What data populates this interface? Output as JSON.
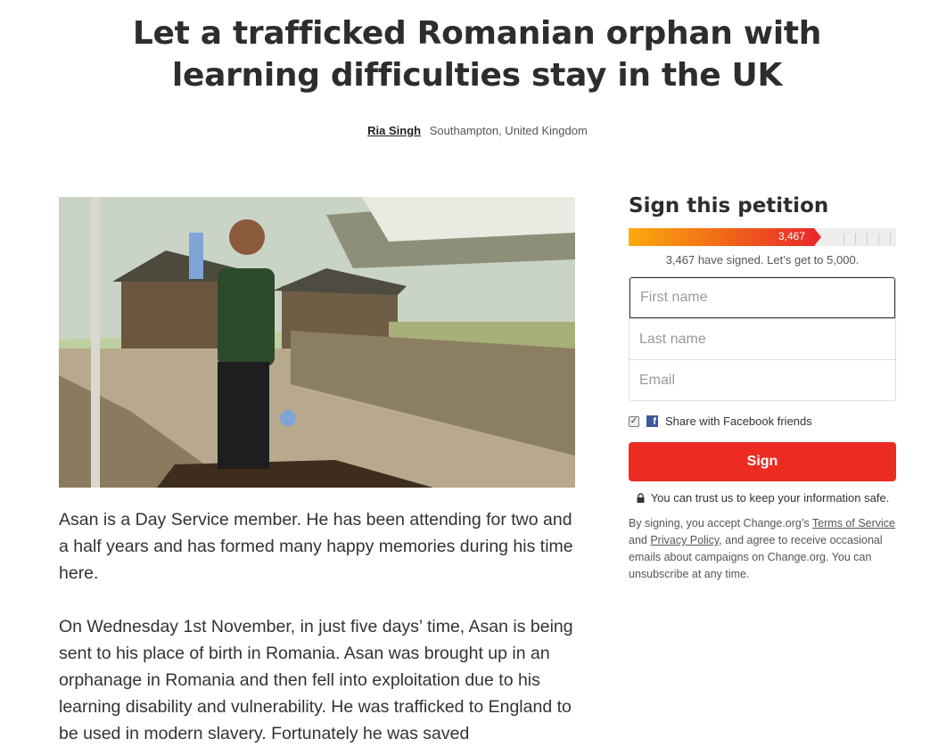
{
  "petition": {
    "title": "Let a trafficked Romanian orphan with learning difficulties stay in the UK",
    "author": "Ria Singh",
    "location": "Southampton, United Kingdom"
  },
  "story": {
    "paragraphs": [
      "Asan is a Day Service member. He has been attending for two and a half years and has formed many happy memories during his time here.",
      "On Wednesday 1st November, in just five days’ time, Asan is being sent to his place of birth in Romania. Asan was brought up in an orphanage in Romania and then fell into exploitation due to his learning disability and vulnerability. He was trafficked to England to be used in modern slavery. Fortunately he was saved"
    ]
  },
  "sign_panel": {
    "heading": "Sign this petition",
    "signature_count": "3,467",
    "signed_fraction": 0.6934,
    "signed_text": "3,467 have signed. Let’s get to 5,000.",
    "first_name_placeholder": "First name",
    "last_name_placeholder": "Last name",
    "email_placeholder": "Email",
    "share_label": "Share with Facebook friends",
    "share_checked": true,
    "sign_button": "Sign",
    "trust_text": "You can trust us to keep your information safe.",
    "legal_prefix": "By signing, you accept Change.org’s ",
    "terms_link": "Terms of Service",
    "legal_and": " and ",
    "privacy_link": "Privacy Policy",
    "legal_suffix": ", and agree to receive occasional emails about campaigns on Change.org. You can unsubscribe at any time."
  },
  "colors": {
    "sign_button": "#ec2c22",
    "progress_start": "#fcaa0e",
    "progress_end": "#ea2a2a",
    "facebook": "#3b5998"
  },
  "icons": {
    "facebook": "facebook-icon",
    "lock": "lock-icon",
    "checkbox": "checkbox-checked"
  }
}
